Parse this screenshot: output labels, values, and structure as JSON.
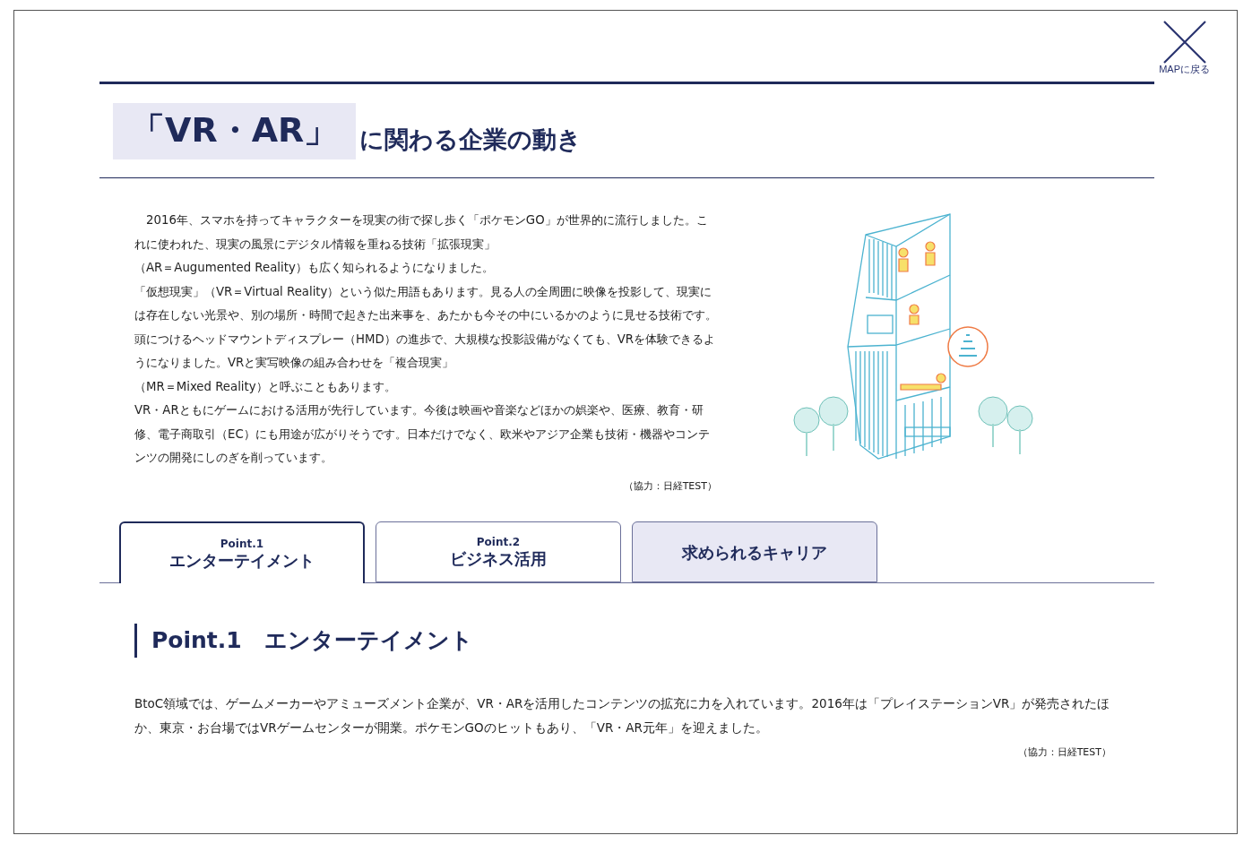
{
  "close_button": {
    "label": "MAPに戻る"
  },
  "title": {
    "highlight": "「VR・AR」",
    "rest": "に関わる企業の動き"
  },
  "intro": {
    "lines": [
      "　2016年、スマホを持ってキャラクターを現実の街で探し歩く「ポケモンGO」が世界的に流行しました。これに使われた、現実の風景にデジタル情報を重ねる技術「拡張現実」",
      "（AR＝Augumented Reality）も広く知られるようになりました。",
      "「仮想現実」（VR＝Virtual Reality）という似た用語もあります。見る人の全周囲に映像を投影して、現実には存在しない光景や、別の場所・時間で起きた出来事を、あたかも今その中にいるかのように見せる技術です。頭につけるヘッドマウントディスプレー（HMD）の進歩で、大規模な投影設備がなくても、VRを体験できるようになりました。VRと実写映像の組み合わせを「複合現実」",
      "（MR＝Mixed Reality）と呼ぶこともあります。",
      "VR・ARともにゲームにおける活用が先行しています。今後は映画や音楽などほかの娯楽や、医療、教育・研修、電子商取引（EC）にも用途が広がりそうです。日本だけでなく、欧米やアジア企業も技術・機器やコンテンツの開発にしのぎを削っています。"
    ],
    "credit": "（協力：日経TEST）"
  },
  "tabs": [
    {
      "kind": "point",
      "caption": "Point.1",
      "label": "エンターテイメント",
      "selected": true
    },
    {
      "kind": "point",
      "caption": "Point.2",
      "label": "ビジネス活用",
      "selected": false
    },
    {
      "kind": "link",
      "label": "求められるキャリア",
      "selected": false
    }
  ],
  "section": {
    "heading": "Point.1　エンターテイメント",
    "text": "BtoC領域では、ゲームメーカーやアミューズメント企業が、VR・ARを活用したコンテンツの拡充に力を入れています。2016年は「プレイステーションVR」が発売されたほか、東京・お台場ではVRゲームセンターが開業。ポケモンGOのヒットもあり、「VR・AR元年」を迎えました。",
    "credit": "（協力：日経TEST）"
  }
}
